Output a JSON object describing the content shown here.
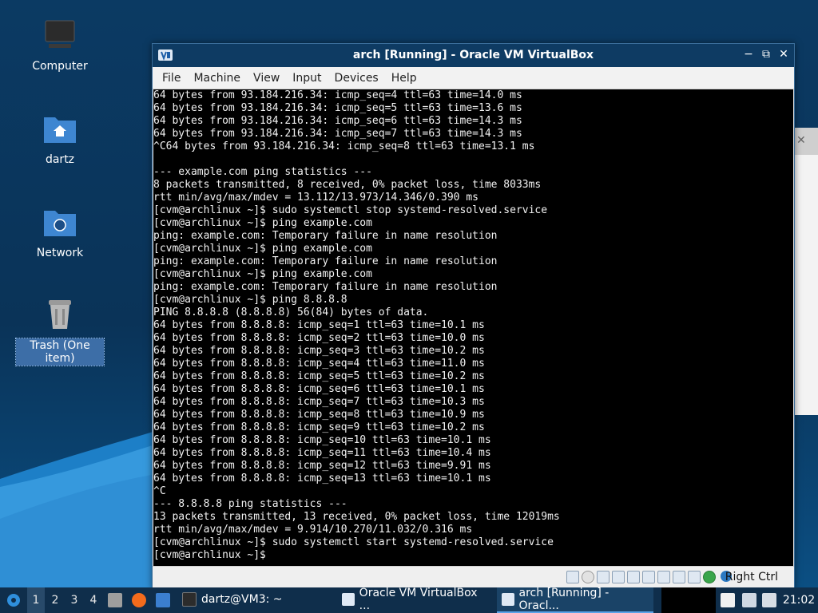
{
  "desktop": {
    "icons": [
      {
        "label": "Computer",
        "icon": "computer-icon"
      },
      {
        "label": "dartz",
        "icon": "home-folder-icon"
      },
      {
        "label": "Network",
        "icon": "network-folder-icon"
      },
      {
        "label": "Trash (One item)",
        "icon": "trash-icon",
        "selected": true
      }
    ]
  },
  "window": {
    "title": "arch [Running] - Oracle VM VirtualBox",
    "controls": {
      "minimize": "−",
      "maximize": "⧉",
      "close": "✕"
    },
    "menu": [
      "File",
      "Machine",
      "View",
      "Input",
      "Devices",
      "Help"
    ],
    "terminal_lines": [
      "64 bytes from 93.184.216.34: icmp_seq=4 ttl=63 time=14.0 ms",
      "64 bytes from 93.184.216.34: icmp_seq=5 ttl=63 time=13.6 ms",
      "64 bytes from 93.184.216.34: icmp_seq=6 ttl=63 time=14.3 ms",
      "64 bytes from 93.184.216.34: icmp_seq=7 ttl=63 time=14.3 ms",
      "^C64 bytes from 93.184.216.34: icmp_seq=8 ttl=63 time=13.1 ms",
      "",
      "--- example.com ping statistics ---",
      "8 packets transmitted, 8 received, 0% packet loss, time 8033ms",
      "rtt min/avg/max/mdev = 13.112/13.973/14.346/0.390 ms",
      "[cvm@archlinux ~]$ sudo systemctl stop systemd-resolved.service",
      "[cvm@archlinux ~]$ ping example.com",
      "ping: example.com: Temporary failure in name resolution",
      "[cvm@archlinux ~]$ ping example.com",
      "ping: example.com: Temporary failure in name resolution",
      "[cvm@archlinux ~]$ ping example.com",
      "ping: example.com: Temporary failure in name resolution",
      "[cvm@archlinux ~]$ ping 8.8.8.8",
      "PING 8.8.8.8 (8.8.8.8) 56(84) bytes of data.",
      "64 bytes from 8.8.8.8: icmp_seq=1 ttl=63 time=10.1 ms",
      "64 bytes from 8.8.8.8: icmp_seq=2 ttl=63 time=10.0 ms",
      "64 bytes from 8.8.8.8: icmp_seq=3 ttl=63 time=10.2 ms",
      "64 bytes from 8.8.8.8: icmp_seq=4 ttl=63 time=11.0 ms",
      "64 bytes from 8.8.8.8: icmp_seq=5 ttl=63 time=10.2 ms",
      "64 bytes from 8.8.8.8: icmp_seq=6 ttl=63 time=10.1 ms",
      "64 bytes from 8.8.8.8: icmp_seq=7 ttl=63 time=10.3 ms",
      "64 bytes from 8.8.8.8: icmp_seq=8 ttl=63 time=10.9 ms",
      "64 bytes from 8.8.8.8: icmp_seq=9 ttl=63 time=10.2 ms",
      "64 bytes from 8.8.8.8: icmp_seq=10 ttl=63 time=10.1 ms",
      "64 bytes from 8.8.8.8: icmp_seq=11 ttl=63 time=10.4 ms",
      "64 bytes from 8.8.8.8: icmp_seq=12 ttl=63 time=9.91 ms",
      "64 bytes from 8.8.8.8: icmp_seq=13 ttl=63 time=10.1 ms",
      "^C",
      "--- 8.8.8.8 ping statistics ---",
      "13 packets transmitted, 13 received, 0% packet loss, time 12019ms",
      "rtt min/avg/max/mdev = 9.914/10.270/11.032/0.316 ms",
      "[cvm@archlinux ~]$ sudo systemctl start systemd-resolved.service",
      "[cvm@archlinux ~]$ "
    ],
    "status": {
      "host_key": "Right Ctrl"
    }
  },
  "taskbar": {
    "workspaces": [
      "1",
      "2",
      "3",
      "4"
    ],
    "active_workspace": "1",
    "tasks": [
      {
        "label": "dartz@VM3: ~",
        "icon": "terminal-icon"
      },
      {
        "label": "Oracle VM VirtualBox ...",
        "icon": "virtualbox-icon"
      },
      {
        "label": "arch [Running] - Oracl...",
        "icon": "virtualbox-icon",
        "active": true
      }
    ],
    "clock": "21:02"
  },
  "colors": {
    "taskbar_bg": "#0f2e4b",
    "titlebar_bg": "#0e3b63",
    "terminal_bg": "#000000",
    "selection": "#3d6ea7"
  }
}
